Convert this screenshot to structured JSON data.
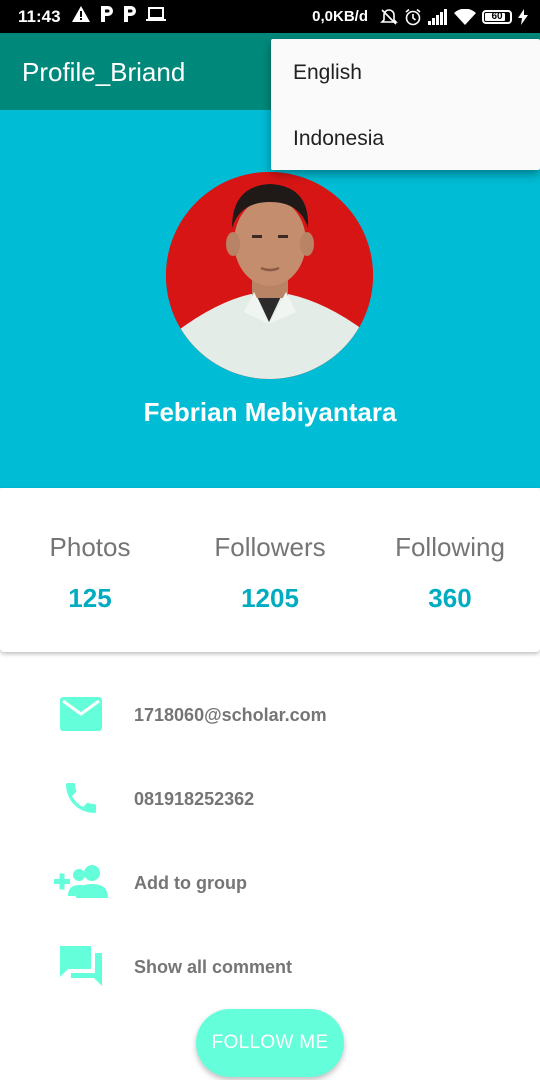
{
  "status_bar": {
    "time": "11:43",
    "network_speed": "0,0KB/d",
    "battery_level": "60",
    "left_icons": [
      "warning-icon",
      "parking-p-icon",
      "parking-p-icon",
      "laptop-icon"
    ],
    "right_icons": [
      "alarm-off-icon",
      "alarm-clock-icon",
      "signal-icon",
      "wifi-icon",
      "battery-icon",
      "charging-icon"
    ]
  },
  "app_bar": {
    "title": "Profile_Briand",
    "color": "#00897b"
  },
  "menu": {
    "items": [
      {
        "label": "English"
      },
      {
        "label": "Indonesia"
      }
    ]
  },
  "profile": {
    "name": "Febrian Mebiyantara",
    "header_color": "#00bcd4",
    "avatar_background": "#d81515"
  },
  "stats": [
    {
      "label": "Photos",
      "value": "125"
    },
    {
      "label": "Followers",
      "value": "1205"
    },
    {
      "label": "Following",
      "value": "360"
    }
  ],
  "info": [
    {
      "icon": "email-icon",
      "text": "1718060@scholar.com"
    },
    {
      "icon": "phone-icon",
      "text": "081918252362"
    },
    {
      "icon": "add-group-icon",
      "text": "Add to group"
    },
    {
      "icon": "comments-icon",
      "text": "Show all comment"
    }
  ],
  "follow_button": {
    "label": "FOLLOW ME",
    "color": "#64ffda"
  },
  "colors": {
    "accent": "#64ffda",
    "stat_value": "#00acc1",
    "secondary_text": "#757575"
  }
}
